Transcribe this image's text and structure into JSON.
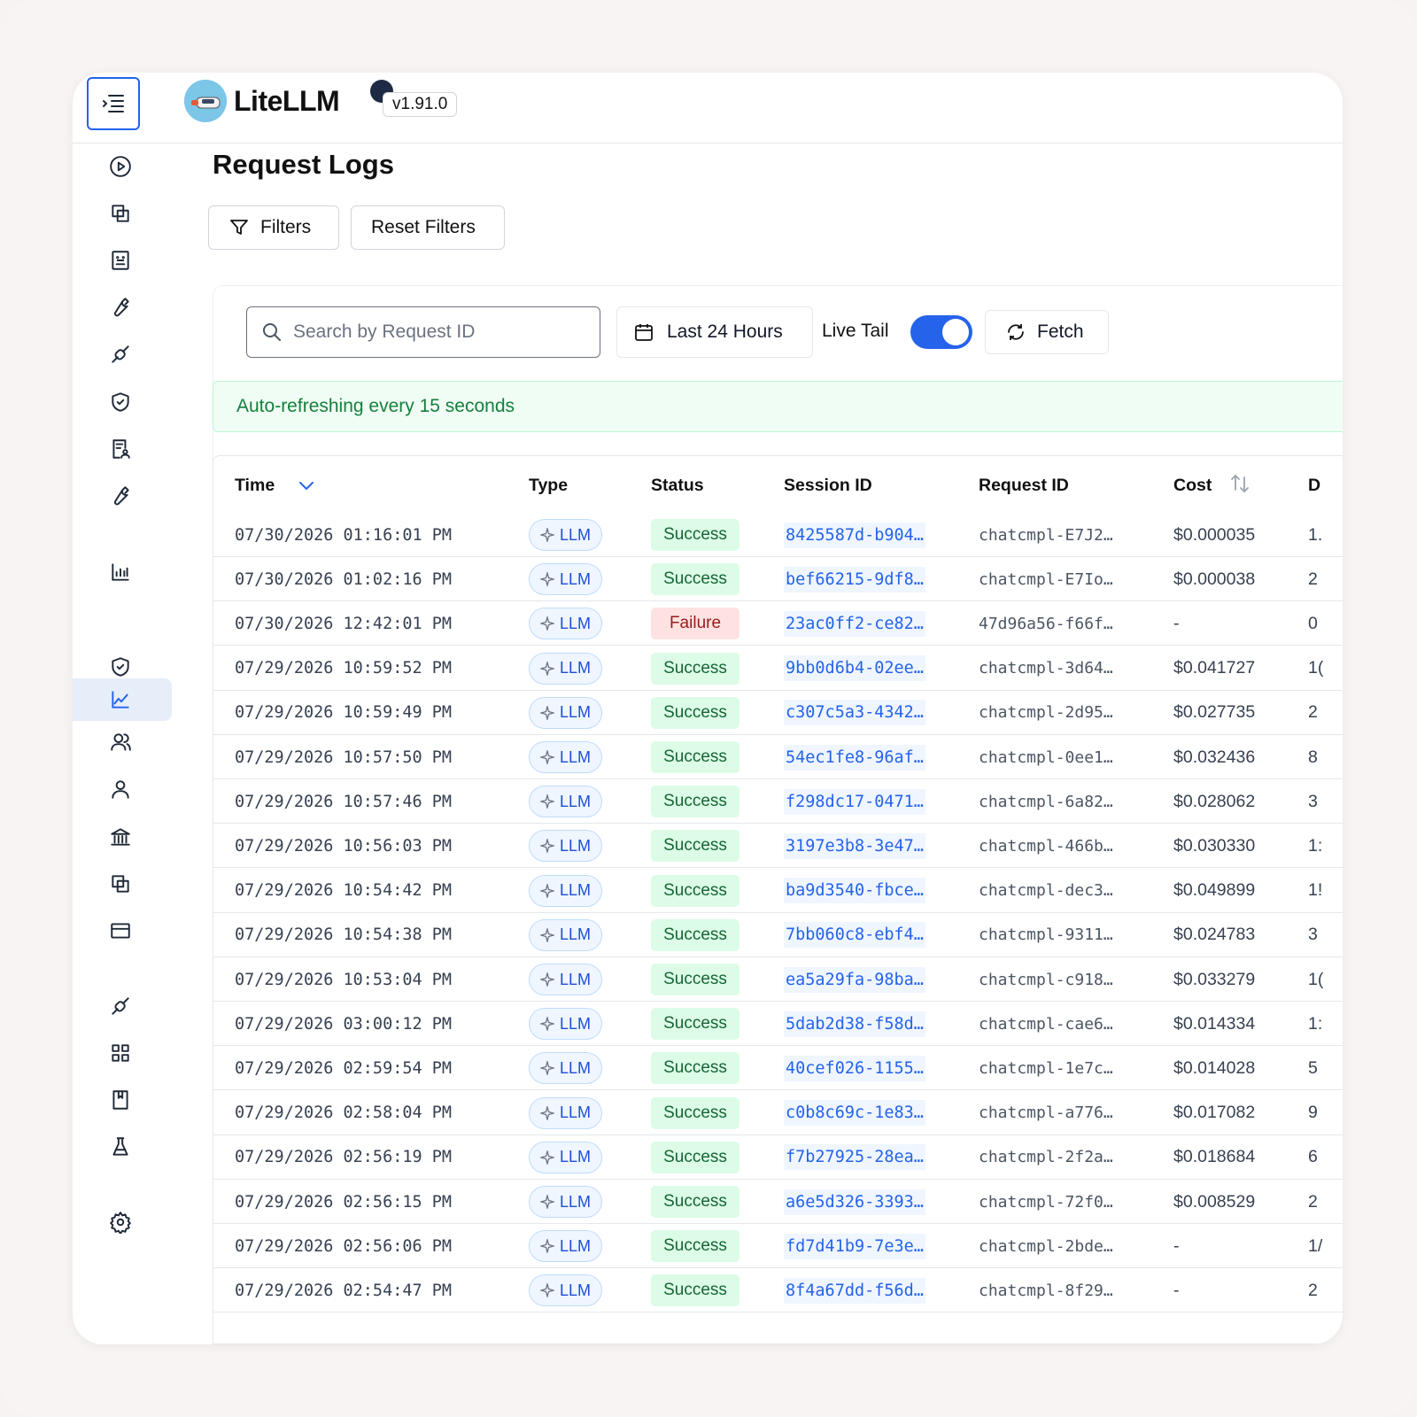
{
  "app": {
    "title": "LiteLLM",
    "version": "v1.91.0"
  },
  "page": {
    "title": "Request Logs"
  },
  "toolbar": {
    "filters_label": "Filters",
    "reset_label": "Reset Filters"
  },
  "controls": {
    "search_placeholder": "Search by Request ID",
    "date_range": "Last 24 Hours",
    "live_tail_label": "Live Tail",
    "live_tail_on": true,
    "fetch_label": "Fetch"
  },
  "banner": {
    "text": "Auto-refreshing every 15 seconds"
  },
  "table": {
    "columns": [
      "Time",
      "Type",
      "Status",
      "Session ID",
      "Request ID",
      "Cost",
      "D"
    ],
    "rows": [
      {
        "time": "07/30/2026 01:16:01 PM",
        "type": "LLM",
        "status": "Success",
        "session": "8425587d-b904…",
        "request": "chatcmpl-E7J2…",
        "cost": "$0.000035",
        "dur": "1."
      },
      {
        "time": "07/30/2026 01:02:16 PM",
        "type": "LLM",
        "status": "Success",
        "session": "bef66215-9df8…",
        "request": "chatcmpl-E7Io…",
        "cost": "$0.000038",
        "dur": "2"
      },
      {
        "time": "07/30/2026 12:42:01 PM",
        "type": "LLM",
        "status": "Failure",
        "session": "23ac0ff2-ce82…",
        "request": "47d96a56-f66f…",
        "cost": "-",
        "dur": "0"
      },
      {
        "time": "07/29/2026 10:59:52 PM",
        "type": "LLM",
        "status": "Success",
        "session": "9bb0d6b4-02ee…",
        "request": "chatcmpl-3d64…",
        "cost": "$0.041727",
        "dur": "1("
      },
      {
        "time": "07/29/2026 10:59:49 PM",
        "type": "LLM",
        "status": "Success",
        "session": "c307c5a3-4342…",
        "request": "chatcmpl-2d95…",
        "cost": "$0.027735",
        "dur": "2"
      },
      {
        "time": "07/29/2026 10:57:50 PM",
        "type": "LLM",
        "status": "Success",
        "session": "54ec1fe8-96af…",
        "request": "chatcmpl-0ee1…",
        "cost": "$0.032436",
        "dur": "8"
      },
      {
        "time": "07/29/2026 10:57:46 PM",
        "type": "LLM",
        "status": "Success",
        "session": "f298dc17-0471…",
        "request": "chatcmpl-6a82…",
        "cost": "$0.028062",
        "dur": "3"
      },
      {
        "time": "07/29/2026 10:56:03 PM",
        "type": "LLM",
        "status": "Success",
        "session": "3197e3b8-3e47…",
        "request": "chatcmpl-466b…",
        "cost": "$0.030330",
        "dur": "1:"
      },
      {
        "time": "07/29/2026 10:54:42 PM",
        "type": "LLM",
        "status": "Success",
        "session": "ba9d3540-fbce…",
        "request": "chatcmpl-dec3…",
        "cost": "$0.049899",
        "dur": "1!"
      },
      {
        "time": "07/29/2026 10:54:38 PM",
        "type": "LLM",
        "status": "Success",
        "session": "7bb060c8-ebf4…",
        "request": "chatcmpl-9311…",
        "cost": "$0.024783",
        "dur": "3"
      },
      {
        "time": "07/29/2026 10:53:04 PM",
        "type": "LLM",
        "status": "Success",
        "session": "ea5a29fa-98ba…",
        "request": "chatcmpl-c918…",
        "cost": "$0.033279",
        "dur": "1("
      },
      {
        "time": "07/29/2026 03:00:12 PM",
        "type": "LLM",
        "status": "Success",
        "session": "5dab2d38-f58d…",
        "request": "chatcmpl-cae6…",
        "cost": "$0.014334",
        "dur": "1:"
      },
      {
        "time": "07/29/2026 02:59:54 PM",
        "type": "LLM",
        "status": "Success",
        "session": "40cef026-1155…",
        "request": "chatcmpl-1e7c…",
        "cost": "$0.014028",
        "dur": "5"
      },
      {
        "time": "07/29/2026 02:58:04 PM",
        "type": "LLM",
        "status": "Success",
        "session": "c0b8c69c-1e83…",
        "request": "chatcmpl-a776…",
        "cost": "$0.017082",
        "dur": "9"
      },
      {
        "time": "07/29/2026 02:56:19 PM",
        "type": "LLM",
        "status": "Success",
        "session": "f7b27925-28ea…",
        "request": "chatcmpl-2f2a…",
        "cost": "$0.018684",
        "dur": "6"
      },
      {
        "time": "07/29/2026 02:56:15 PM",
        "type": "LLM",
        "status": "Success",
        "session": "a6e5d326-3393…",
        "request": "chatcmpl-72f0…",
        "cost": "$0.008529",
        "dur": "2"
      },
      {
        "time": "07/29/2026 02:56:06 PM",
        "type": "LLM",
        "status": "Success",
        "session": "fd7d41b9-7e3e…",
        "request": "chatcmpl-2bde…",
        "cost": "-",
        "dur": "1/"
      },
      {
        "time": "07/29/2026 02:54:47 PM",
        "type": "LLM",
        "status": "Success",
        "session": "8f4a67dd-f56d…",
        "request": "chatcmpl-8f29…",
        "cost": "-",
        "dur": "2"
      }
    ]
  },
  "sidebar": {
    "icons": [
      "play-circle-icon",
      "copy-icon",
      "document-icon",
      "wrench-icon",
      "plug-icon",
      "shield-check-icon",
      "receipt-user-icon",
      "wrench-icon",
      "bar-chart-icon",
      "line-chart-icon",
      "shield-check-icon",
      "users-icon",
      "user-icon",
      "bank-icon",
      "copy-icon",
      "credit-card-icon",
      "plug-icon",
      "grid-icon",
      "book-icon",
      "flask-icon",
      "gear-icon"
    ],
    "active_index": 9
  },
  "colors": {
    "accent": "#2563eb",
    "success_bg": "#dcfce7",
    "failure_bg": "#fee2e2",
    "banner_bg": "#f0fdf4"
  }
}
